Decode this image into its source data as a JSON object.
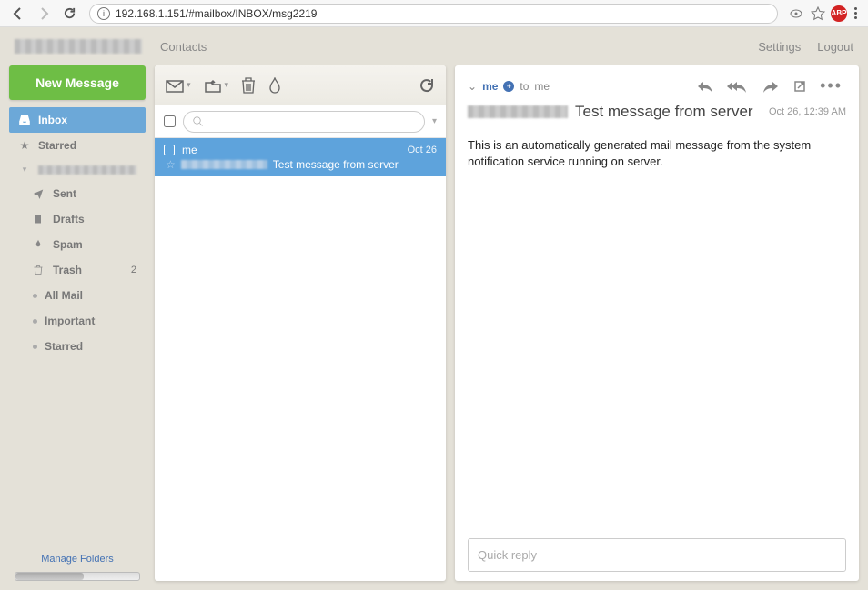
{
  "browser": {
    "url": "192.168.1.151/#mailbox/INBOX/msg2219"
  },
  "topnav": {
    "contacts": "Contacts",
    "settings": "Settings",
    "logout": "Logout"
  },
  "sidebar": {
    "new_message": "New Message",
    "folders": {
      "inbox": "Inbox",
      "starred": "Starred",
      "sent": "Sent",
      "drafts": "Drafts",
      "spam": "Spam",
      "trash": "Trash",
      "trash_count": "2",
      "all_mail": "All Mail",
      "important": "Important",
      "starred_sub": "Starred"
    },
    "manage": "Manage Folders"
  },
  "messages": {
    "item0": {
      "from": "me",
      "date": "Oct 26",
      "subject": "Test message from server"
    }
  },
  "reader": {
    "from": "me",
    "to_prefix": "to",
    "to": "me",
    "subject": "Test message from server",
    "date": "Oct 26, 12:39 AM",
    "body": "This is an automatically generated mail message from the system notification service running on server.",
    "quick_reply": "Quick reply"
  },
  "search": {
    "placeholder": ""
  }
}
